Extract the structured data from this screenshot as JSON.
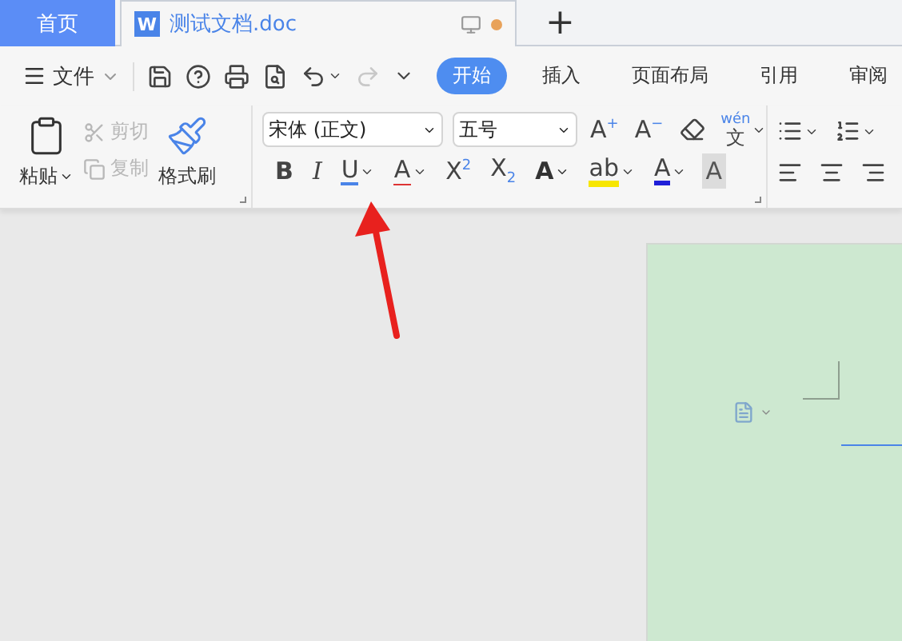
{
  "tabs": [
    {
      "kind": "home",
      "label": "首页",
      "selected": false
    },
    {
      "kind": "document",
      "badge": "W",
      "label": "测试文档.doc",
      "selected": true,
      "unsaved": true
    }
  ],
  "new_tab": "+",
  "file_menu": {
    "label": "文件"
  },
  "quick_tools": [
    {
      "kind": "save",
      "disabled": false,
      "dropdown": false
    },
    {
      "kind": "help",
      "disabled": false,
      "dropdown": false
    },
    {
      "kind": "print",
      "disabled": false,
      "dropdown": false
    },
    {
      "kind": "preview",
      "disabled": false,
      "dropdown": false
    },
    {
      "kind": "undo",
      "disabled": false,
      "dropdown": true
    },
    {
      "kind": "redo",
      "disabled": true,
      "dropdown": false
    },
    {
      "kind": "more",
      "disabled": false,
      "dropdown": false
    }
  ],
  "ribbon_tabs": [
    {
      "label": "开始",
      "selected": true
    },
    {
      "label": "插入",
      "selected": false
    },
    {
      "label": "页面布局",
      "selected": false
    },
    {
      "label": "引用",
      "selected": false
    },
    {
      "label": "审阅",
      "selected": false
    }
  ],
  "clipboard": {
    "paste": "粘贴",
    "cut": {
      "label": "剪切",
      "disabled": true
    },
    "copy": {
      "label": "复制",
      "disabled": true
    },
    "format_painter": "格式刷"
  },
  "font": {
    "name": "宋体 (正文)",
    "size": "五号",
    "top_buttons": [
      {
        "kind": "grow",
        "glyph": "A$^{+}$"
      },
      {
        "kind": "shrink",
        "glyph": "A$^{−}$"
      },
      {
        "kind": "eraser"
      },
      {
        "kind": "pinyin",
        "ruby": "wén",
        "glyph": "文",
        "dropdown": true
      }
    ],
    "format_buttons": [
      {
        "kind": "bold",
        "glyph": "B",
        "dropdown": false
      },
      {
        "kind": "italic",
        "glyph": "I",
        "dropdown": false
      },
      {
        "kind": "underline",
        "glyph": "U",
        "dropdown": true
      },
      {
        "kind": "strike",
        "glyph": "A",
        "dropdown": true
      },
      {
        "kind": "plain",
        "glyph": "X$^{2}$",
        "dropdown": false
      },
      {
        "kind": "plain",
        "glyph": "X$_{2}$",
        "dropdown": false
      },
      {
        "kind": "outline",
        "glyph": "A",
        "dropdown": true
      },
      {
        "kind": "highlight",
        "glyph": "ab",
        "dropdown": true
      },
      {
        "kind": "color",
        "glyph": "A",
        "dropdown": true
      },
      {
        "kind": "shade",
        "glyph": "A",
        "dropdown": false
      }
    ]
  },
  "paragraph": {
    "top_buttons": [
      {
        "kind": "bullets",
        "dropdown": true
      },
      {
        "kind": "numbering",
        "dropdown": true
      }
    ],
    "align_buttons": [
      {
        "kind": "left"
      },
      {
        "kind": "center"
      },
      {
        "kind": "right"
      }
    ]
  }
}
